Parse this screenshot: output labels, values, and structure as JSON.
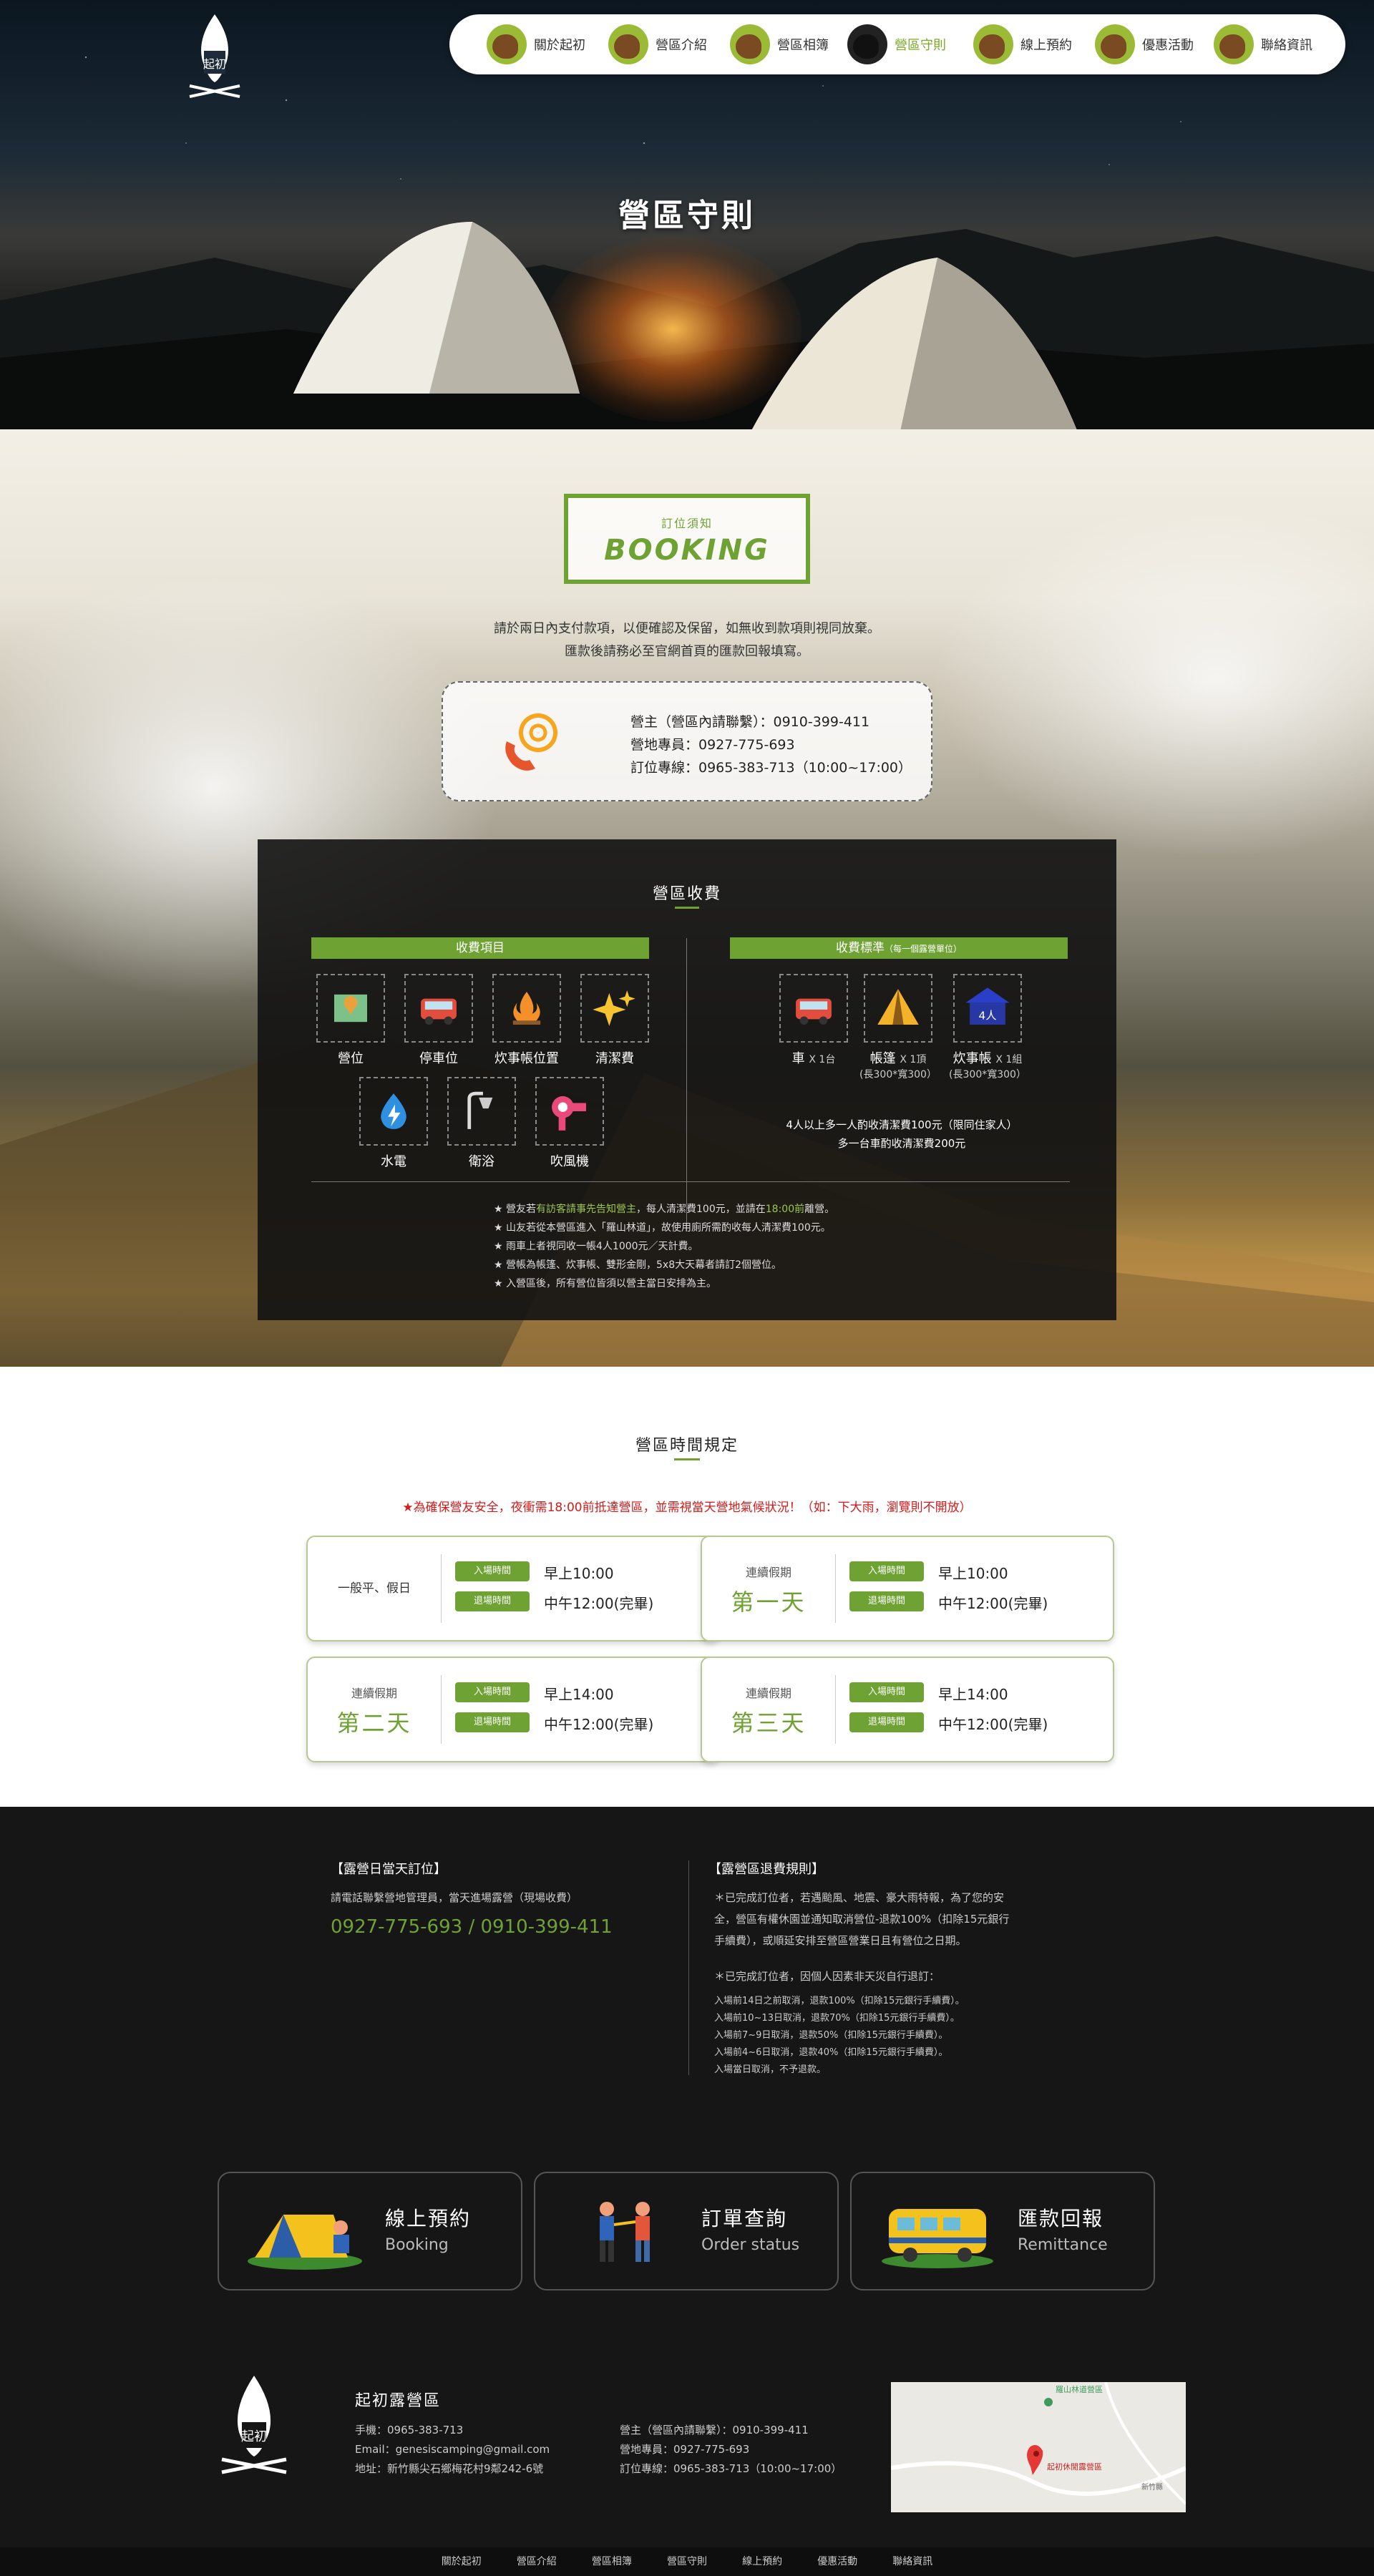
{
  "nav": {
    "items": [
      {
        "label": "關於起初"
      },
      {
        "label": "營區介紹"
      },
      {
        "label": "營區相簿"
      },
      {
        "label": "營區守則"
      },
      {
        "label": "線上預約"
      },
      {
        "label": "優惠活動"
      },
      {
        "label": "聯絡資訊"
      }
    ],
    "active_index": 3
  },
  "logo": {
    "text": "起初"
  },
  "hero": {
    "title": "營區守則"
  },
  "booking": {
    "box_sub": "訂位須知",
    "box_title": "BOOKING",
    "intro_line1": "請於兩日內支付款項，以便確認及保留，如無收到款項則視同放棄。",
    "intro_line2": "匯款後請務必至官網首頁的匯款回報填寫。",
    "contact": [
      "營主（營區內請聯繫）：0910-399-411",
      "營地專員：0927-775-693",
      "訂位專線：0965-383-713（10:00~17:00）"
    ]
  },
  "fee": {
    "title": "營區收費",
    "items_header": "收費項目",
    "standard_header": "收費標準",
    "standard_header_note": "（每一個露營單位）",
    "items": [
      {
        "label": "營位",
        "icon": "map-icon"
      },
      {
        "label": "停車位",
        "icon": "car-icon"
      },
      {
        "label": "炊事帳位置",
        "icon": "campfire-icon"
      },
      {
        "label": "清潔費",
        "icon": "sparkle-icon"
      },
      {
        "label": "水電",
        "icon": "water-electric-icon"
      },
      {
        "label": "衛浴",
        "icon": "shower-icon"
      },
      {
        "label": "吹風機",
        "icon": "hairdryer-icon"
      }
    ],
    "standards": [
      {
        "label": "車",
        "qty": "X 1台",
        "note": ""
      },
      {
        "label": "帳篷",
        "qty": "X 1頂",
        "note": "(長300*寬300）"
      },
      {
        "label": "炊事帳",
        "qty": "X 1組",
        "note": "(長300*寬300）"
      }
    ],
    "canopy_tag": "4人",
    "extra_line1": "4人以上多一人酌收清潔費100元（限同住家人）",
    "extra_line2": "多一台車酌收清潔費200元",
    "notes": [
      {
        "pre": "★ 營友若",
        "hl": "有訪客請事先告知營主",
        "post": "，每人清潔費100元，並請在"
      },
      {
        "pre": "★ 山友若從本營區進入「羅山林道」，故使用廁所需酌收每人清潔費100元。",
        "hl": "",
        "post": ""
      },
      {
        "pre": "★ 雨車上者視同收一帳4人1000元／天計費。",
        "hl": "",
        "post": ""
      },
      {
        "pre": "★ 營帳為帳篷、炊事帳、雙形金剛，5x8大天幕者請訂2個營位。",
        "hl": "",
        "post": ""
      },
      {
        "pre": "★ 入營區後，所有營位皆須以營主當日安排為主。",
        "hl": "",
        "post": ""
      }
    ],
    "note1_time": "18:00前",
    "note1_end": "離營。"
  },
  "time": {
    "title": "營區時間規定",
    "warning": "★為確保營友安全，夜衝需18:00前抵達營區，並需視當天營地氣候狀況！（如：下大雨，瀏覽則不開放）",
    "checkin_label": "入場時間",
    "checkout_label": "退場時間",
    "cards": [
      {
        "small": "",
        "big": "",
        "only": "一般平、假日",
        "in": "早上10:00",
        "out": "中午12:00(完畢)"
      },
      {
        "small": "連續假期",
        "big": "第一天",
        "only": "",
        "in": "早上10:00",
        "out": "中午12:00(完畢)"
      },
      {
        "small": "連續假期",
        "big": "第二天",
        "only": "",
        "in": "早上14:00",
        "out": "中午12:00(完畢)"
      },
      {
        "small": "連續假期",
        "big": "第三天",
        "only": "",
        "in": "早上14:00",
        "out": "中午12:00(完畢)"
      }
    ]
  },
  "info": {
    "day_title": "【露營日當天訂位】",
    "day_text": "請電話聯繫營地管理員，當天進場露營（現場收費）",
    "day_phone": "0927-775-693 / 0910-399-411",
    "refund_title": "【露營區退費規則】",
    "refund_p1": [
      "＊已完成訂位者，若遇颱風、地震、豪大雨特報，為了您的安",
      "全，營區有權休園並通知取消營位-退款100%（扣除15元銀行",
      "手續費），或順延安排至營區營業日且有營位之日期。"
    ],
    "refund_p2": "＊已完成訂位者，因個人因素非天災自行退訂：",
    "refund_list": [
      "入場前14日之前取消，退款100%（扣除15元銀行手續費）。",
      "入場前10~13日取消，退款70%（扣除15元銀行手續費）。",
      "入場前7~9日取消，退款50%（扣除15元銀行手續費）。",
      "入場前4~6日取消，退款40%（扣除15元銀行手續費）。",
      "入場當日取消，不予退款。"
    ]
  },
  "quick": [
    {
      "title": "線上預約",
      "sub": "Booking"
    },
    {
      "title": "訂單查詢",
      "sub": "Order status"
    },
    {
      "title": "匯款回報",
      "sub": "Remittance"
    }
  ],
  "footer": {
    "name": "起初露營區",
    "mobile": "手機：0965-383-713",
    "email": "Email：genesiscamping@gmail.com",
    "address": "地址：新竹縣尖石鄉梅花村9鄰242-6號",
    "contact": [
      "營主（營區內請聯繫）：0910-399-411",
      "營地專員：0927-775-693",
      "訂位專線：0965-383-713（10:00~17:00）"
    ],
    "map_label1": "羅山林道營區",
    "map_label2": "起初休閒露營區",
    "map_label3": "新竹縣"
  },
  "bottom_nav": [
    "關於起初",
    "營區介紹",
    "營區相簿",
    "營區守則",
    "線上預約",
    "優惠活動",
    "聯絡資訊"
  ],
  "colors": {
    "accent": "#6ea232",
    "warning": "#d41b1b",
    "dark": "#161616"
  }
}
